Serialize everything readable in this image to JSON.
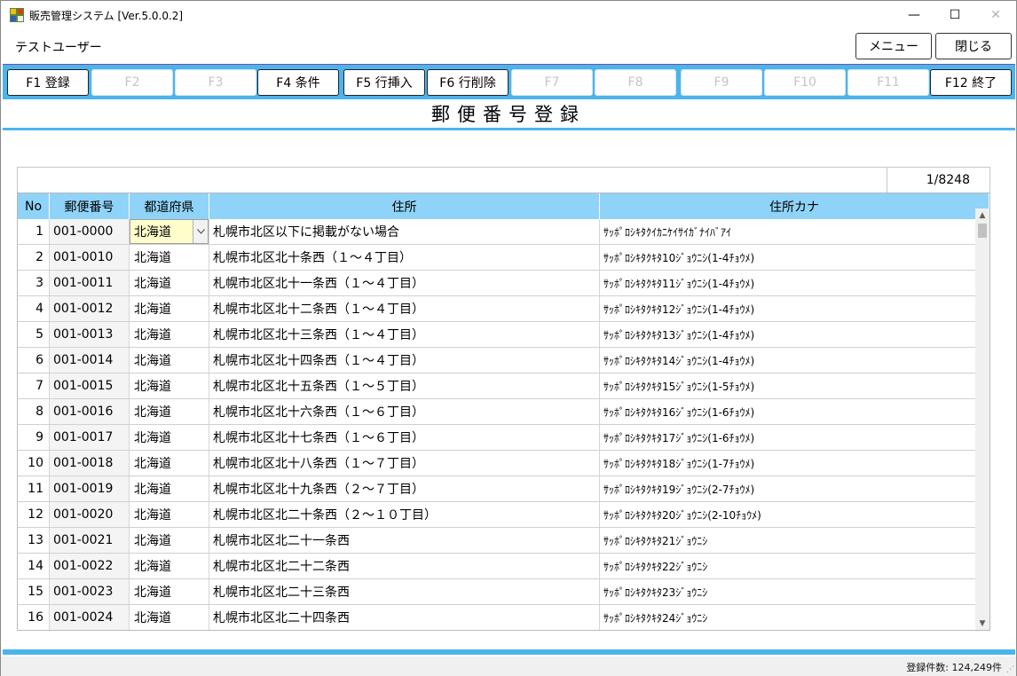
{
  "window": {
    "title": "販売管理システム [Ver.5.0.0.2]",
    "minimize_glyph": "—",
    "maximize_glyph": "☐",
    "close_glyph": "✕"
  },
  "header": {
    "user": "テストユーザー",
    "menu_label": "メニュー",
    "close_label": "閉じる"
  },
  "function_keys": [
    {
      "label": "F1 登録",
      "enabled": true
    },
    {
      "label": "F2",
      "enabled": false
    },
    {
      "label": "F3",
      "enabled": false
    },
    {
      "label": "F4 条件",
      "enabled": true
    },
    {
      "label": "F5 行挿入",
      "enabled": true
    },
    {
      "label": "F6 行削除",
      "enabled": true
    },
    {
      "label": "F7",
      "enabled": false
    },
    {
      "label": "F8",
      "enabled": false
    },
    {
      "label": "F9",
      "enabled": false
    },
    {
      "label": "F10",
      "enabled": false
    },
    {
      "label": "F11",
      "enabled": false
    },
    {
      "label": "F12 終了",
      "enabled": true
    }
  ],
  "page": {
    "title": "郵便番号登録",
    "pager": "1/8248"
  },
  "table": {
    "columns": [
      "No",
      "郵便番号",
      "都道府県",
      "住所",
      "住所カナ"
    ],
    "rows": [
      {
        "no": "1",
        "zip": "001-0000",
        "pref": "北海道",
        "addr": "札幌市北区以下に掲載がない場合",
        "kana": "ｻｯﾎﾟﾛｼｷﾀｸｲｶﾆｹｲｻｲｶﾞﾅｲﾊﾞｱｲ"
      },
      {
        "no": "2",
        "zip": "001-0010",
        "pref": "北海道",
        "addr": "札幌市北区北十条西（１～４丁目）",
        "kana": "ｻｯﾎﾟﾛｼｷﾀｸｷﾀ10ｼﾞｮｳﾆｼ(1-4ﾁｮｳﾒ)"
      },
      {
        "no": "3",
        "zip": "001-0011",
        "pref": "北海道",
        "addr": "札幌市北区北十一条西（１～４丁目）",
        "kana": "ｻｯﾎﾟﾛｼｷﾀｸｷﾀ11ｼﾞｮｳﾆｼ(1-4ﾁｮｳﾒ)"
      },
      {
        "no": "4",
        "zip": "001-0012",
        "pref": "北海道",
        "addr": "札幌市北区北十二条西（１～４丁目）",
        "kana": "ｻｯﾎﾟﾛｼｷﾀｸｷﾀ12ｼﾞｮｳﾆｼ(1-4ﾁｮｳﾒ)"
      },
      {
        "no": "5",
        "zip": "001-0013",
        "pref": "北海道",
        "addr": "札幌市北区北十三条西（１～４丁目）",
        "kana": "ｻｯﾎﾟﾛｼｷﾀｸｷﾀ13ｼﾞｮｳﾆｼ(1-4ﾁｮｳﾒ)"
      },
      {
        "no": "6",
        "zip": "001-0014",
        "pref": "北海道",
        "addr": "札幌市北区北十四条西（１～４丁目）",
        "kana": "ｻｯﾎﾟﾛｼｷﾀｸｷﾀ14ｼﾞｮｳﾆｼ(1-4ﾁｮｳﾒ)"
      },
      {
        "no": "7",
        "zip": "001-0015",
        "pref": "北海道",
        "addr": "札幌市北区北十五条西（１～５丁目）",
        "kana": "ｻｯﾎﾟﾛｼｷﾀｸｷﾀ15ｼﾞｮｳﾆｼ(1-5ﾁｮｳﾒ)"
      },
      {
        "no": "8",
        "zip": "001-0016",
        "pref": "北海道",
        "addr": "札幌市北区北十六条西（１～６丁目）",
        "kana": "ｻｯﾎﾟﾛｼｷﾀｸｷﾀ16ｼﾞｮｳﾆｼ(1-6ﾁｮｳﾒ)"
      },
      {
        "no": "9",
        "zip": "001-0017",
        "pref": "北海道",
        "addr": "札幌市北区北十七条西（１～６丁目）",
        "kana": "ｻｯﾎﾟﾛｼｷﾀｸｷﾀ17ｼﾞｮｳﾆｼ(1-6ﾁｮｳﾒ)"
      },
      {
        "no": "10",
        "zip": "001-0018",
        "pref": "北海道",
        "addr": "札幌市北区北十八条西（１～７丁目）",
        "kana": "ｻｯﾎﾟﾛｼｷﾀｸｷﾀ18ｼﾞｮｳﾆｼ(1-7ﾁｮｳﾒ)"
      },
      {
        "no": "11",
        "zip": "001-0019",
        "pref": "北海道",
        "addr": "札幌市北区北十九条西（２～７丁目）",
        "kana": "ｻｯﾎﾟﾛｼｷﾀｸｷﾀ19ｼﾞｮｳﾆｼ(2-7ﾁｮｳﾒ)"
      },
      {
        "no": "12",
        "zip": "001-0020",
        "pref": "北海道",
        "addr": "札幌市北区北二十条西（２～１０丁目）",
        "kana": "ｻｯﾎﾟﾛｼｷﾀｸｷﾀ20ｼﾞｮｳﾆｼ(2-10ﾁｮｳﾒ)"
      },
      {
        "no": "13",
        "zip": "001-0021",
        "pref": "北海道",
        "addr": "札幌市北区北二十一条西",
        "kana": "ｻｯﾎﾟﾛｼｷﾀｸｷﾀ21ｼﾞｮｳﾆｼ"
      },
      {
        "no": "14",
        "zip": "001-0022",
        "pref": "北海道",
        "addr": "札幌市北区北二十二条西",
        "kana": "ｻｯﾎﾟﾛｼｷﾀｸｷﾀ22ｼﾞｮｳﾆｼ"
      },
      {
        "no": "15",
        "zip": "001-0023",
        "pref": "北海道",
        "addr": "札幌市北区北二十三条西",
        "kana": "ｻｯﾎﾟﾛｼｷﾀｸｷﾀ23ｼﾞｮｳﾆｼ"
      },
      {
        "no": "16",
        "zip": "001-0024",
        "pref": "北海道",
        "addr": "札幌市北区北二十四条西",
        "kana": "ｻｯﾎﾟﾛｼｷﾀｸｷﾀ24ｼﾞｮｳﾆｼ"
      }
    ]
  },
  "status": {
    "count_text": "登録件数: 124,249件"
  },
  "colors": {
    "accent": "#4cb4ec",
    "header_cell": "#8fd3f8",
    "selected_cell": "#ffffcc"
  }
}
